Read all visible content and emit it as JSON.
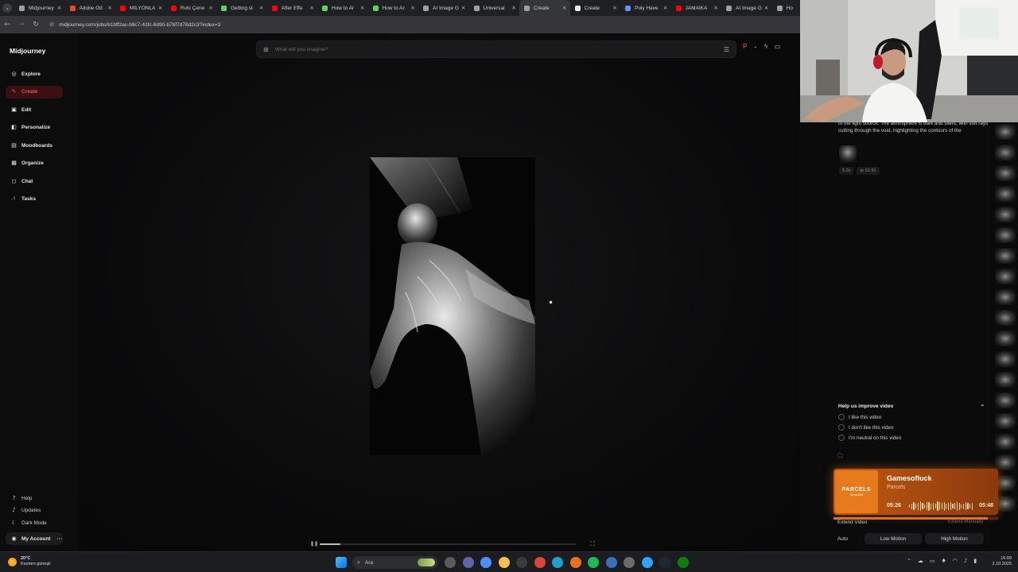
{
  "browser": {
    "tabs": [
      {
        "label": "Midjourney",
        "color": "#9aa0a6"
      },
      {
        "label": "Adobe Öd",
        "color": "#e34f2b"
      },
      {
        "label": "MİLYONLA",
        "color": "#ff0000"
      },
      {
        "label": "Ruhi Çene",
        "color": "#ff0000"
      },
      {
        "label": "Getting st",
        "color": "#5fd35f"
      },
      {
        "label": "After Effe",
        "color": "#ff0000"
      },
      {
        "label": "How to Ar",
        "color": "#5fd35f"
      },
      {
        "label": "How to Ar",
        "color": "#5fd35f"
      },
      {
        "label": "AI Image G",
        "color": "#9aa0a6"
      },
      {
        "label": "Universal",
        "color": "#9aa0a6"
      },
      {
        "label": "Create",
        "color": "#9aa0a6",
        "active": true
      },
      {
        "label": "Create",
        "color": "#e8e8e8"
      },
      {
        "label": "Poly Have",
        "color": "#6b8cff"
      },
      {
        "label": "JAMAİKA",
        "color": "#ff0000"
      },
      {
        "label": "AI Image G",
        "color": "#9aa0a6"
      },
      {
        "label": "Ho",
        "color": "#9aa0a6"
      }
    ],
    "url": "midjourney.com/jobs/b1bff2ac-b9c7-41fc-8d90-b76f7d78d2c3?index=3"
  },
  "sidebar": {
    "logo": "Midjourney",
    "items": [
      {
        "label": "Explore",
        "icon": "compass-icon",
        "glyph": "◎"
      },
      {
        "label": "Create",
        "icon": "brush-icon",
        "glyph": "✎",
        "active": true
      },
      {
        "label": "Edit",
        "icon": "edit-icon",
        "glyph": "▣"
      },
      {
        "label": "Personalize",
        "icon": "personalize-icon",
        "glyph": "◧"
      },
      {
        "label": "Moodboards",
        "icon": "moodboard-icon",
        "glyph": "▤"
      },
      {
        "label": "Organize",
        "icon": "folder-grid-icon",
        "glyph": "▦"
      },
      {
        "label": "Chat",
        "icon": "chat-icon",
        "glyph": "◻"
      },
      {
        "label": "Tasks",
        "icon": "thumbs-up-icon",
        "glyph": "☝"
      }
    ],
    "footer": [
      {
        "label": "Help",
        "icon": "help-icon",
        "glyph": "?"
      },
      {
        "label": "Updates",
        "icon": "bell-icon",
        "glyph": "♪"
      },
      {
        "label": "Dark Mode",
        "icon": "moon-icon",
        "glyph": "☾"
      }
    ],
    "account": {
      "label": "My Account",
      "more": "···"
    }
  },
  "prompt": {
    "placeholder": "What will you imagine?"
  },
  "details": {
    "description": "of the light source. The atmosphere is dark and silent, with soft rays cutting through the void, highlighting the contours of the",
    "chips": [
      "5.2s",
      "ar 51:91"
    ]
  },
  "feedback": {
    "title": "Help us improve video",
    "collapse": "⌃",
    "options": [
      "I like this video",
      "I don't like this video",
      "I'm neutral on this video"
    ]
  },
  "video_controls": {
    "extend_label": "Extend Video",
    "extend_manual": "Extend Manually",
    "auto_label": "Auto",
    "low_motion": "Low Motion",
    "high_motion": "High Motion",
    "progress_fraction": 0.08
  },
  "music": {
    "album_title": "PARCELS",
    "album_sub": "Somethinf",
    "track": "Gamesofluck",
    "artist": "Parcels",
    "elapsed": "05:26",
    "total": "05:48",
    "progress_fraction": 0.937,
    "accent": "#e6711c"
  },
  "taskbar": {
    "temperature": "20°C",
    "weather": "Kısmen güneşli",
    "search": "Ara",
    "time": "16:09",
    "date": "2.10.2025"
  }
}
